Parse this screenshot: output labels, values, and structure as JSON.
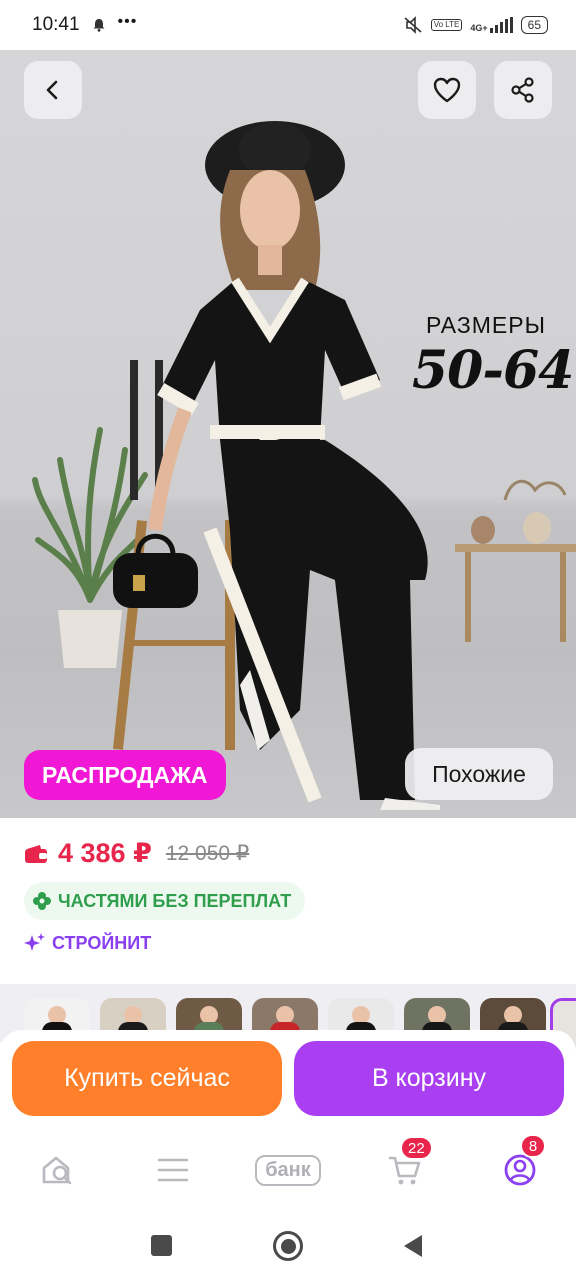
{
  "status_bar": {
    "time": "10:41",
    "network": "4G+",
    "volte": "Vo LTE",
    "battery": "65"
  },
  "hero": {
    "sizes_title": "РАЗМЕРЫ",
    "sizes_range": "50-64",
    "sale_badge": "РАСПРОДАЖА",
    "similar_button": "Похожие",
    "icons": [
      "back-arrow-icon",
      "heart-icon",
      "share-icon"
    ]
  },
  "product": {
    "price_current": "4 386 ₽",
    "price_old": "12 050 ₽",
    "installment_label": "ЧАСТЯМИ БЕЗ ПЕРЕПЛАТ",
    "slim_label": "СТРОЙНИТ"
  },
  "thumbnails": [
    {
      "colour": "#f2f2f2",
      "body": "#111111"
    },
    {
      "colour": "#d9d0c4",
      "body": "#1b1b1b"
    },
    {
      "colour": "#6f5a45",
      "body": "#5b7f5a"
    },
    {
      "colour": "#8c7868",
      "body": "#c8252b"
    },
    {
      "colour": "#e9e9ea",
      "body": "#141414"
    },
    {
      "colour": "#6f7462",
      "body": "#161616"
    },
    {
      "colour": "#5c4a3a",
      "body": "#191919"
    }
  ],
  "actions": {
    "buy_now": "Купить сейчас",
    "add_to_cart": "В корзину"
  },
  "bottom_nav": {
    "bank_label": "банк",
    "cart_badge": "22",
    "profile_badge": "8"
  },
  "colors": {
    "sale": "#f018d4",
    "price": "#e8254a",
    "buy": "#ff7f2a",
    "cart": "#a93ff0"
  }
}
